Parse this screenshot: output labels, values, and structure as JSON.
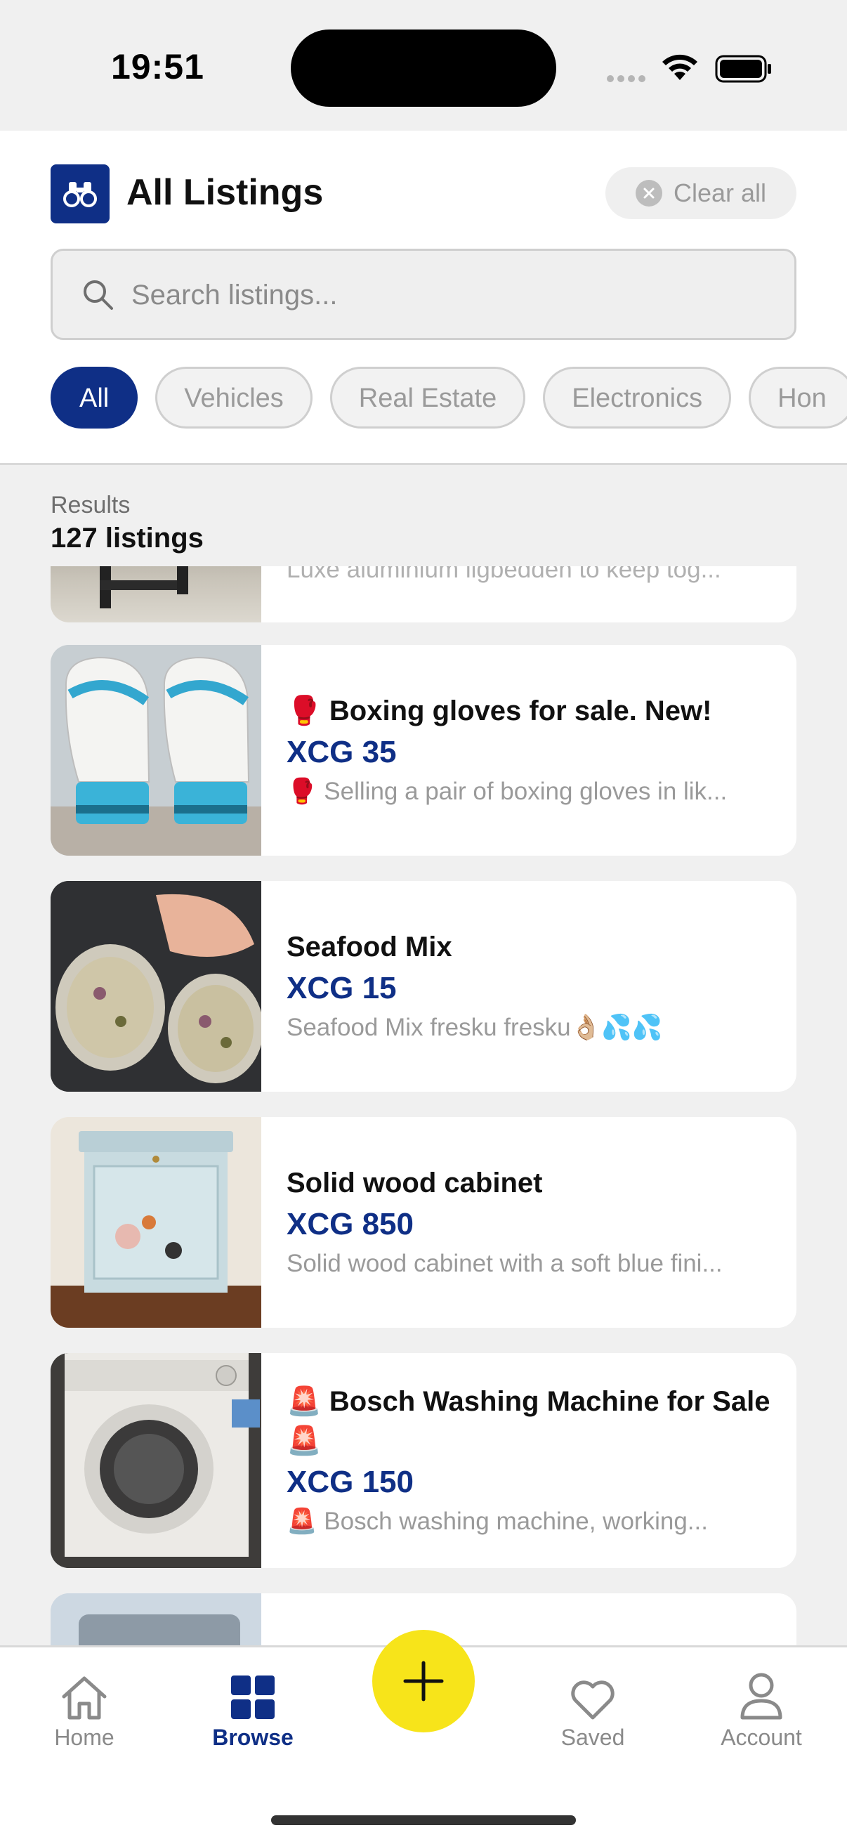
{
  "status_bar": {
    "time": "19:51"
  },
  "header": {
    "title": "All Listings",
    "clear_all_label": "Clear all"
  },
  "search": {
    "placeholder": "Search listings..."
  },
  "categories": [
    "All",
    "Vehicles",
    "Real Estate",
    "Electronics",
    "Hon"
  ],
  "active_category": "All",
  "results": {
    "caption": "Results",
    "count": "127 listings"
  },
  "listings": [
    {
      "title": "",
      "price": "",
      "description": "Luxe aluminium ligbedden to keep tog..."
    },
    {
      "title": "🥊 Boxing gloves for sale. New!",
      "price": "XCG 35",
      "description": "🥊 Selling a pair of boxing gloves in lik..."
    },
    {
      "title": "Seafood Mix",
      "price": "XCG 15",
      "description": "Seafood Mix fresku fresku👌🏼💦💦"
    },
    {
      "title": "Solid wood cabinet",
      "price": "XCG 850",
      "description": "Solid wood cabinet with a soft blue fini..."
    },
    {
      "title": "🚨 Bosch Washing Machine for Sale 🚨",
      "price": "XCG 150",
      "description": "🚨 Bosch washing machine, working..."
    }
  ],
  "tab_bar": {
    "home": "Home",
    "browse": "Browse",
    "saved": "Saved",
    "account": "Account"
  },
  "colors": {
    "brand_navy": "#0f2f86",
    "fab_yellow": "#f7e41a",
    "background": "#f0f0f0"
  },
  "icons": {
    "logo": "binoculars-icon",
    "clear": "close-circle-icon",
    "search": "search-icon",
    "home": "home-icon",
    "browse": "grid-icon",
    "add": "plus-icon",
    "saved": "heart-icon",
    "account": "person-icon"
  }
}
